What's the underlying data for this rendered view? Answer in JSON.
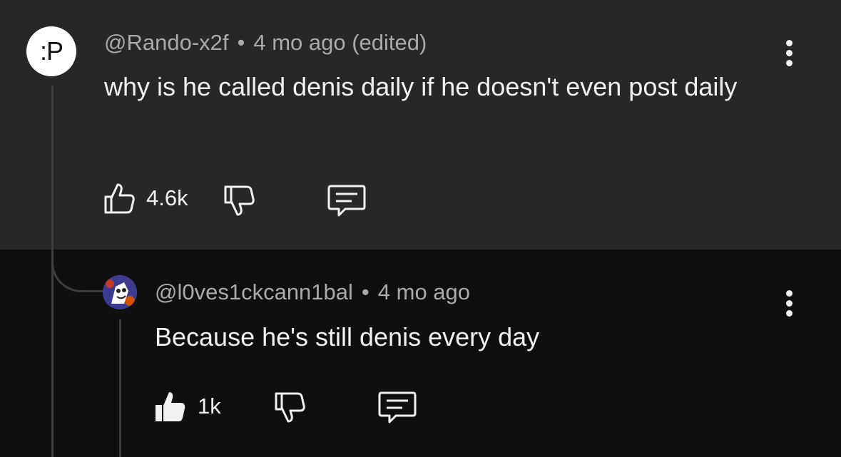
{
  "comment": {
    "avatar_text": ":P",
    "author": "@Rando-x2f",
    "separator": "•",
    "time": "4 mo ago (edited)",
    "text": "why is he called denis daily if he doesn't even post daily",
    "likes": "4.6k",
    "icons": {
      "like": "thumb-up-outline-icon",
      "dislike": "thumb-down-outline-icon",
      "reply": "comment-reply-icon",
      "menu": "more-vertical-icon"
    }
  },
  "reply": {
    "author": "@l0ves1ckcann1bal",
    "separator": "•",
    "time": "4 mo ago",
    "text": "Because he's still denis every day",
    "likes": "1k",
    "liked": true,
    "icons": {
      "like": "thumb-up-filled-icon",
      "dislike": "thumb-down-outline-icon",
      "reply": "comment-reply-icon",
      "menu": "more-vertical-icon"
    }
  },
  "colors": {
    "top_background": "#272727",
    "page_background": "#0f0f0f",
    "text_primary": "#f1f1f1",
    "text_secondary": "#aaaaaa",
    "thread_line": "#3d3d3d"
  }
}
